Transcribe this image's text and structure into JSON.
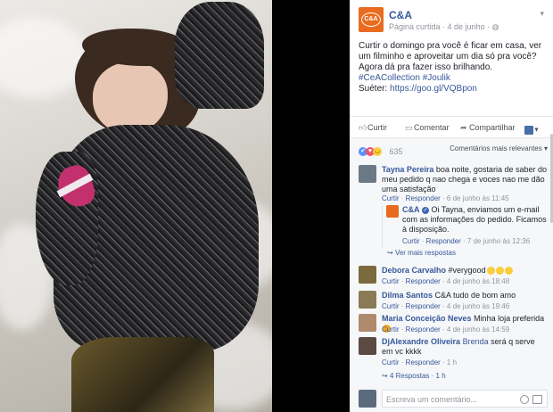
{
  "page": {
    "name": "C&A",
    "logo_text": "C&A",
    "meta": "Página curtida · 4 de junho · ",
    "meta_icon": "globe-icon",
    "options_icon": "chevron-down-icon"
  },
  "post": {
    "text": "Curtir o domingo pra você é ficar em casa, ver um filminho e aproveitar um dia só pra você? Agora dá pra fazer isso brilhando.",
    "hashtag1": "#CeACollection",
    "hashtag2": "#Joulik",
    "sueter_label": "Suéter:",
    "link": "https://goo.gl/VQBpon"
  },
  "actions": {
    "like": "Curtir",
    "comment": "Comentar",
    "share": "Compartilhar"
  },
  "reactions": {
    "count": "635",
    "sort": "Comentários mais relevantes ▾"
  },
  "comments": [
    {
      "name": "Tayna Pereira",
      "text": "boa noite, gostaria de saber do meu pedido q nao chega e voces nao me dão uma satisfação",
      "like": "Curtir",
      "reply": "Responder",
      "time": "6 de junho às 11:45",
      "reply_item": {
        "name": "C&A",
        "text": "Oi Tayna, enviamos um e-mail com as informações do pedido. Ficamos à disposição.",
        "like": "Curtir",
        "reply": "Responder",
        "time": "7 de junho às 12:36"
      },
      "more": "Ver mais respostas"
    },
    {
      "name": "Debora Carvalho",
      "text": "#verygood",
      "like": "Curtir",
      "reply": "Responder",
      "time": "4 de junho às 18:48"
    },
    {
      "name": "Dilma Santos",
      "text": "C&A tudo de bom amo",
      "like": "Curtir",
      "reply": "Responder",
      "time": "4 de junho às 19:46"
    },
    {
      "name": "Maria Conceição Neves",
      "text": "Minha loja preferida",
      "like": "Curtir",
      "reply": "Responder",
      "time": "4 de junho às 14:59"
    },
    {
      "name": "DjAlexandre Oliveira",
      "tag": "Brenda",
      "text": "será q serve em vc kkkk",
      "like": "Curtir",
      "reply": "Responder",
      "time": "1 h",
      "more": "4 Respostas · 1 h"
    }
  ],
  "composer": {
    "placeholder": "Escreva um comentário..."
  },
  "colors": {
    "brand": "#e86b1f",
    "link": "#365899",
    "meta": "#90949c"
  }
}
